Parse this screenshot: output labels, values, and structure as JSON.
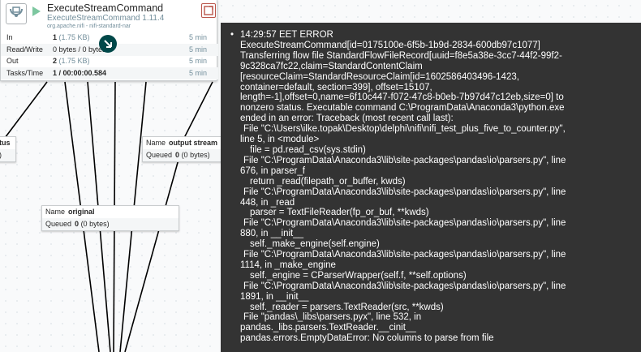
{
  "processor": {
    "name": "ExecuteStreamCommand",
    "type_version": "ExecuteStreamCommand 1.11.4",
    "bundle": "org.apache.nifi - nifi-standard-nar",
    "stats": [
      {
        "label": "In",
        "count": "1",
        "size": "(1.75 KB)",
        "time": "5 min"
      },
      {
        "label": "Read/Write",
        "count": "0 bytes / 0 bytes",
        "size": "",
        "time": "5 min"
      },
      {
        "label": "Out",
        "count": "2",
        "size": "(1.75 KB)",
        "time": "5 min"
      },
      {
        "label": "Tasks/Time",
        "count": "1 / 00:00:00.584",
        "size": "",
        "time": "5 min"
      }
    ]
  },
  "connections": {
    "status": {
      "name_value": "tus",
      "queued_label": "",
      "queued_value": ")"
    },
    "output_stream": {
      "name_label": "Name",
      "name_value": "output stream",
      "queued_label": "Queued",
      "queued_count": "0",
      "queued_size": "(0 bytes)"
    },
    "original": {
      "name_label": "Name",
      "name_value": "original",
      "queued_label": "Queued",
      "queued_count": "0",
      "queued_size": "(0 bytes)"
    }
  },
  "bulletin": {
    "timestamp_level": "14:29:57 EET  ERROR",
    "lines": [
      "ExecuteStreamCommand[id=0175100e-6f5b-1b9d-2834-600db97c1077]",
      "Transferring flow file StandardFlowFileRecord[uuid=f8e5a38e-3cc7-44f2-99f2-",
      "9c328ca7fc22,claim=StandardContentClaim",
      "[resourceClaim=StandardResourceClaim[id=1602586403496-1423,",
      "container=default, section=399], offset=15107,",
      "length=-1],offset=0,name=6f10c447-f072-47c8-b0eb-7b97d47c12eb,size=0] to",
      "nonzero status. Executable command C:\\ProgramData\\Anaconda3\\python.exe",
      "ended in an error: Traceback (most recent call last):",
      "  File \"C:\\Users\\ilke.topak\\Desktop\\delphi\\nifi\\nifi_test_plus_five_to_counter.py\",",
      "line 5, in <module>",
      "    file = pd.read_csv(sys.stdin)",
      "  File \"C:\\ProgramData\\Anaconda3\\lib\\site-packages\\pandas\\io\\parsers.py\", line",
      "676, in parser_f",
      "    return _read(filepath_or_buffer, kwds)",
      "  File \"C:\\ProgramData\\Anaconda3\\lib\\site-packages\\pandas\\io\\parsers.py\", line",
      "448, in _read",
      "    parser = TextFileReader(fp_or_buf, **kwds)",
      "  File \"C:\\ProgramData\\Anaconda3\\lib\\site-packages\\pandas\\io\\parsers.py\", line",
      "880, in __init__",
      "    self._make_engine(self.engine)",
      "  File \"C:\\ProgramData\\Anaconda3\\lib\\site-packages\\pandas\\io\\parsers.py\", line",
      "1114, in _make_engine",
      "    self._engine = CParserWrapper(self.f, **self.options)",
      "  File \"C:\\ProgramData\\Anaconda3\\lib\\site-packages\\pandas\\io\\parsers.py\", line",
      "1891, in __init__",
      "    self._reader = parsers.TextReader(src, **kwds)",
      "  File \"pandas\\_libs\\parsers.pyx\", line 532, in",
      "pandas._libs.parsers.TextReader.__cinit__",
      "pandas.errors.EmptyDataError: No columns to parse from file"
    ]
  },
  "colors": {
    "tooltip_bg": "#333333",
    "canvas_bg": "#f9fafb",
    "bulletin_red": "#ba554a",
    "run_green": "#7dc7a0"
  }
}
